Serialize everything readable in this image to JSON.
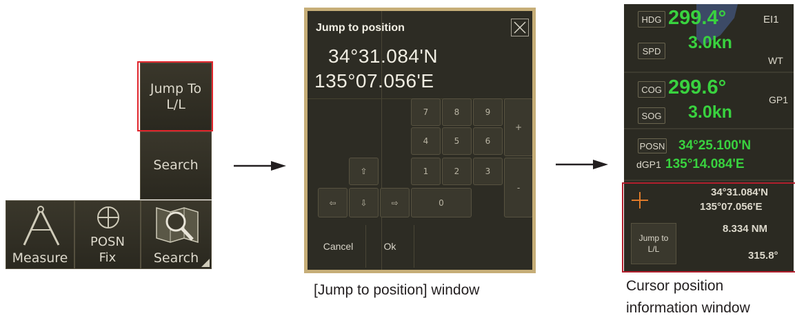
{
  "menu": {
    "jump_to_ll": "Jump To\nL/L",
    "search_upper": "Search",
    "measure": "Measure",
    "posn_fix": "POSN\nFix",
    "search": "Search"
  },
  "dialog": {
    "title": "Jump to position",
    "lat": "34°31.084'N",
    "lon": "135°07.056'E",
    "keys": [
      "7",
      "8",
      "9",
      "4",
      "5",
      "6",
      "1",
      "2",
      "3",
      "0",
      "+",
      "-"
    ],
    "cancel": "Cancel",
    "ok": "Ok",
    "caption": "[Jump to position] window"
  },
  "cursor_panel": {
    "hdg_label": "HDG",
    "hdg_value": "299.4°",
    "hdg_source": "EI1",
    "spd_label": "SPD",
    "spd_value": "3.0kn",
    "spd_source": "WT",
    "cog_label": "COG",
    "cog_value": "299.6°",
    "cog_source": "GP1",
    "sog_label": "SOG",
    "sog_value": "3.0kn",
    "posn_label": "POSN",
    "posn_lat": "34°25.100'N",
    "posn_source": "dGP1",
    "posn_lon": "135°14.084'E",
    "cursor_lat": "34°31.084'N",
    "cursor_lon": "135°07.056'E",
    "range": "8.334 NM",
    "bearing": "315.8°",
    "jump_button": "Jump to\nL/L",
    "caption_line1": "Cursor position",
    "caption_line2": "information window"
  },
  "colors": {
    "panel_bg": "#2d2c24",
    "value_green": "#39d23f",
    "highlight_red": "#e0242b",
    "cursor_orange": "#e07b2a"
  },
  "icons": [
    "divider-compass-icon",
    "crosshair-circle-icon",
    "map-magnifier-icon",
    "arrow-up-icon",
    "arrow-down-icon",
    "arrow-left-icon",
    "arrow-right-icon",
    "close-icon",
    "cursor-cross-icon"
  ]
}
